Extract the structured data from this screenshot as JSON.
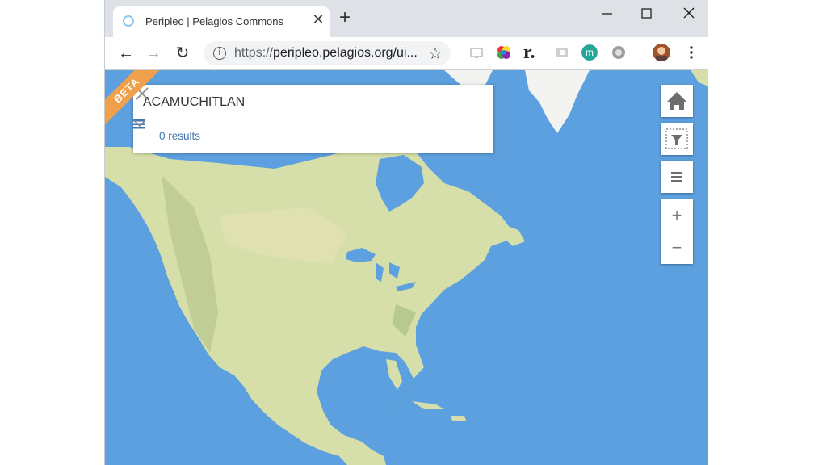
{
  "browser": {
    "tab_title": "Peripleo | Pelagios Commons",
    "tab_close": "✕",
    "new_tab": "+",
    "window": {
      "minimize": "–",
      "maximize": "☐",
      "close": "✕"
    },
    "nav": {
      "back": "←",
      "forward": "→",
      "reload": "↻"
    },
    "url_protocol": "https://",
    "url_rest": "peripleo.pelagios.org/ui...",
    "info": "i",
    "bookmark": "☆",
    "ext_r": "r."
  },
  "app": {
    "beta_label": "BETA",
    "search": {
      "value": "ACAMUCHITLAN",
      "placeholder": ""
    },
    "results": {
      "label": "0 results"
    },
    "zoom": {
      "in": "+",
      "out": "−"
    }
  },
  "colors": {
    "ocean": "#5da0df",
    "land": "#d6dfa9",
    "beta_ribbon": "#f0a04b",
    "results_link": "#3e77b3"
  },
  "icons": [
    "search-clear-icon",
    "list-icon",
    "chevron-down-icon",
    "home-icon",
    "filter-icon",
    "menu-icon"
  ]
}
